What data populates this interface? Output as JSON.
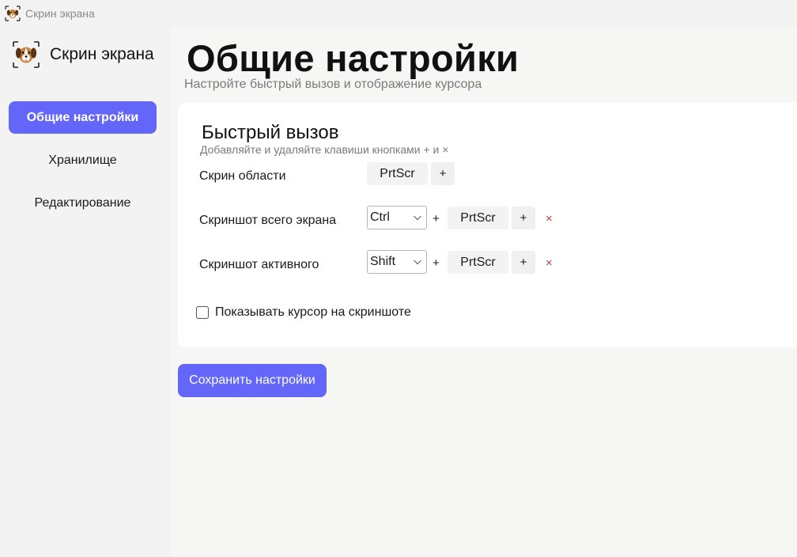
{
  "window": {
    "title": "Скрин экрана"
  },
  "sidebar": {
    "brand_name": "Скрин экрана",
    "items": [
      {
        "label": "Общие настройки",
        "active": true
      },
      {
        "label": "Хранилище",
        "active": false
      },
      {
        "label": "Редактирование",
        "active": false
      }
    ]
  },
  "main": {
    "title": "Общие настройки",
    "subtitle": "Настройте быстрый вызов и отображение курсора",
    "hotkeys": {
      "title": "Быстрый вызов",
      "hint": "Добавляйте и удаляйте клавиши кнопками + и ×",
      "rows": [
        {
          "label": "Скрин области",
          "key": "PrtScr",
          "add": "+"
        },
        {
          "label": "Скриншот всего экрана",
          "modifier": "Ctrl",
          "plus": "+",
          "key": "PrtScr",
          "add": "+",
          "remove": "×"
        },
        {
          "label": "Скриншот активного",
          "modifier": "Shift",
          "plus": "+",
          "key": "PrtScr",
          "add": "+",
          "remove": "×"
        }
      ]
    },
    "show_cursor": {
      "label": "Показывать курсор на скриншоте",
      "checked": false
    },
    "save_label": "Сохранить настройки"
  },
  "colors": {
    "accent": "#6366f8",
    "remove": "#c04040"
  }
}
